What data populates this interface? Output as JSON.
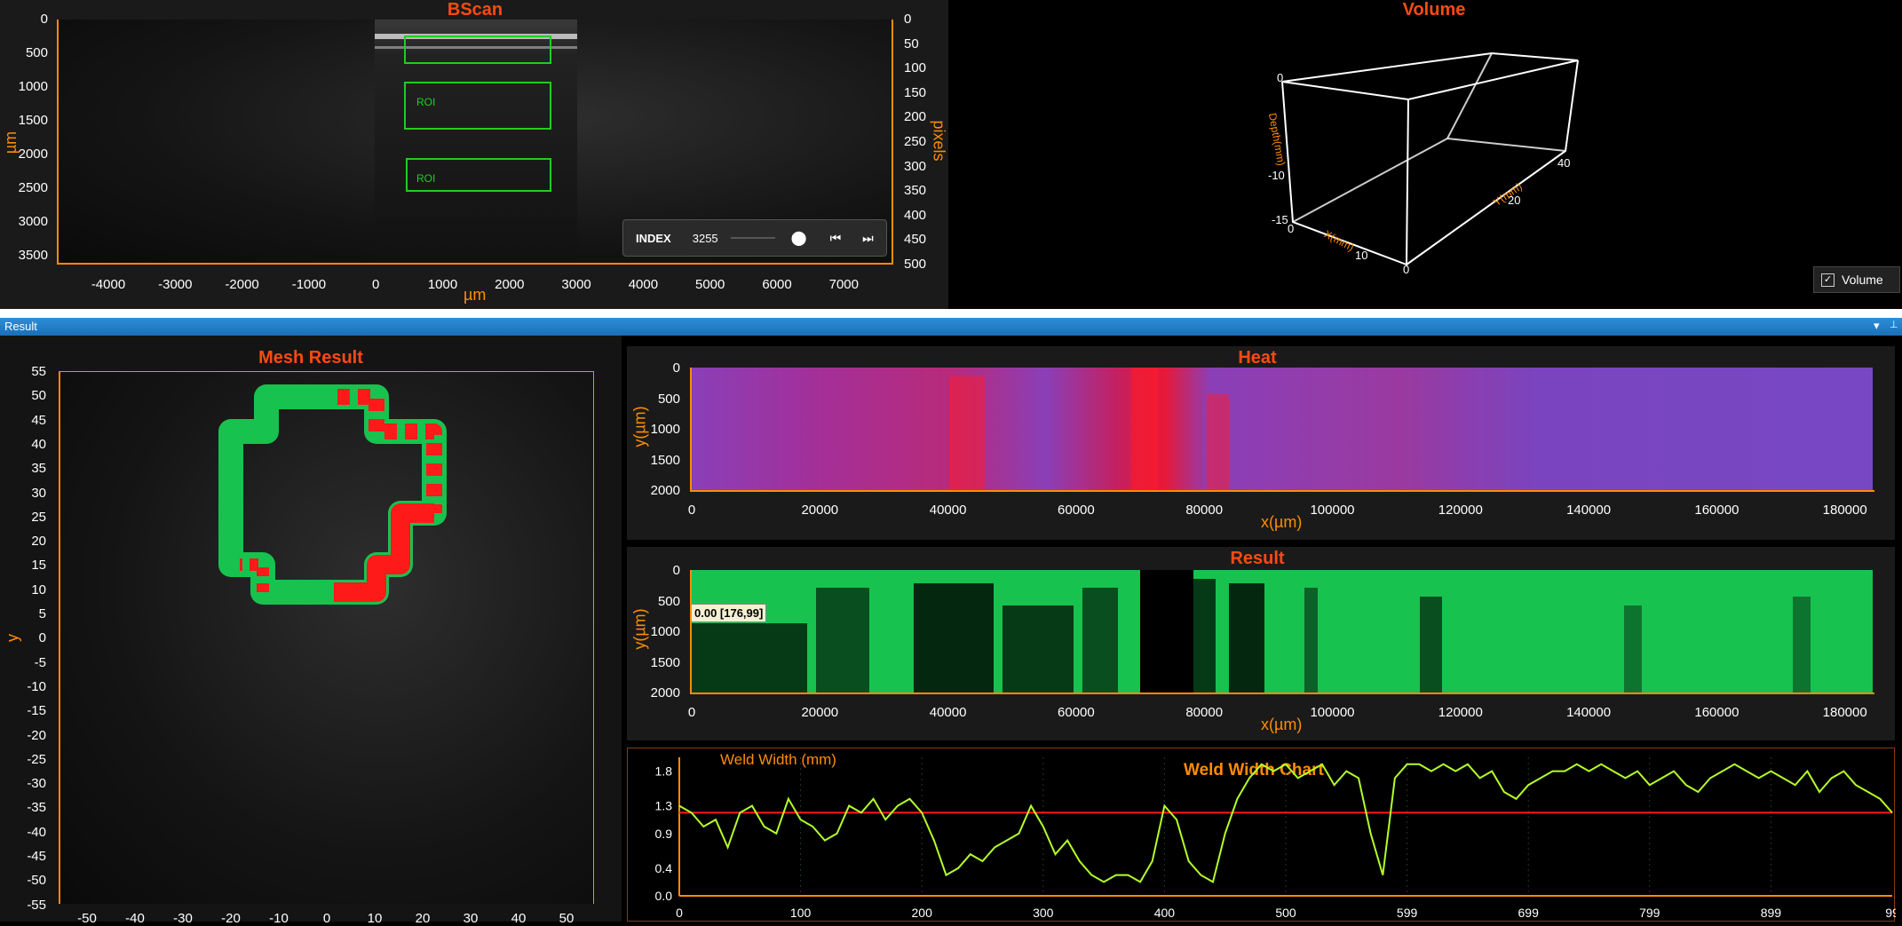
{
  "colors": {
    "accent": "#ff4a12",
    "axis": "#ff8c00",
    "roi": "#22cc22",
    "green": "#17c24f",
    "red": "#ff1a1a",
    "lime": "#b4ff28"
  },
  "bscan": {
    "title": "BScan",
    "left_ticks": [
      "0",
      "500",
      "1000",
      "1500",
      "2000",
      "2500",
      "3000",
      "3500"
    ],
    "left_label": "µm",
    "right_ticks": [
      "0",
      "50",
      "100",
      "150",
      "200",
      "250",
      "300",
      "350",
      "400",
      "450",
      "500"
    ],
    "right_label": "pixels",
    "bottom_ticks": [
      "-4000",
      "-3000",
      "-2000",
      "-1000",
      "0",
      "1000",
      "2000",
      "3000",
      "4000",
      "5000",
      "6000",
      "7000"
    ],
    "bottom_label": "µm",
    "roi_labels": [
      "ROI",
      "ROI",
      "ROI"
    ],
    "index_label": "INDEX",
    "index_value": "3255",
    "index_buttons": {
      "locate": "location-pin-icon",
      "first": "skip-first-icon",
      "last": "skip-last-icon"
    }
  },
  "volume": {
    "title": "Volume",
    "labels": {
      "x_axis": "X(mm)",
      "y_axis": "Y(mm)",
      "depth": "Depth(mm)"
    },
    "ticks": {
      "t0a": "0",
      "t10": "-10",
      "t15": "-15",
      "t0b": "0",
      "x10": "10",
      "x0": "0",
      "y20": "20",
      "y40": "40"
    },
    "checkbox_label": "Volume",
    "checkbox_checked": true
  },
  "result_header": {
    "label": "Result",
    "menu": "▾",
    "pin": "📌"
  },
  "mesh": {
    "title": "Mesh Result",
    "y_ticks": [
      "55",
      "50",
      "45",
      "40",
      "35",
      "30",
      "25",
      "20",
      "15",
      "10",
      "5",
      "0",
      "-5",
      "-10",
      "-15",
      "-20",
      "-25",
      "-30",
      "-35",
      "-40",
      "-45",
      "-50",
      "-55"
    ],
    "y_label": "y",
    "x_ticks": [
      "-50",
      "-40",
      "-30",
      "-20",
      "-10",
      "0",
      "10",
      "20",
      "30",
      "40",
      "50"
    ]
  },
  "heat": {
    "title": "Heat",
    "y_ticks": [
      "0",
      "500",
      "1000",
      "1500",
      "2000"
    ],
    "y_label": "y(µm)",
    "x_ticks": [
      "0",
      "20000",
      "40000",
      "60000",
      "80000",
      "100000",
      "120000",
      "140000",
      "160000",
      "180000"
    ],
    "x_label": "x(µm)"
  },
  "result_chart": {
    "title": "Result",
    "y_ticks": [
      "0",
      "500",
      "1000",
      "1500",
      "2000"
    ],
    "y_label": "y(µm)",
    "x_ticks": [
      "0",
      "20000",
      "40000",
      "60000",
      "80000",
      "100000",
      "120000",
      "140000",
      "160000",
      "180000"
    ],
    "x_label": "x(µm)",
    "tooltip": "0.00 [176,99]"
  },
  "chart_data": {
    "type": "line",
    "title": "Weld Width Chart",
    "ylabel": "Weld Width (mm)",
    "y_ticks": [
      "1.8",
      "1.3",
      "0.9",
      "0.4",
      "0.0"
    ],
    "x_ticks": [
      "0",
      "100",
      "200",
      "300",
      "400",
      "500",
      "599",
      "699",
      "799",
      "899",
      "99"
    ],
    "ylim": [
      0,
      2.0
    ],
    "xlim": [
      0,
      1000
    ],
    "threshold": 1.2,
    "series": [
      {
        "x": [
          0,
          10,
          20,
          30,
          40,
          50,
          60,
          70,
          80,
          90,
          100,
          110,
          120,
          130,
          140,
          150,
          160,
          170,
          180,
          190,
          200,
          210,
          220,
          230,
          240,
          250,
          260,
          270,
          280,
          290,
          300,
          310,
          320,
          330,
          340,
          350,
          360,
          370,
          380,
          390,
          400,
          410,
          420,
          430,
          440,
          450,
          460,
          470,
          480,
          490,
          500,
          510,
          520,
          530,
          540,
          550,
          560,
          570,
          580,
          590,
          600,
          610,
          620,
          630,
          640,
          650,
          660,
          670,
          680,
          690,
          700,
          710,
          720,
          730,
          740,
          750,
          760,
          770,
          780,
          790,
          800,
          810,
          820,
          830,
          840,
          850,
          860,
          870,
          880,
          890,
          900,
          910,
          920,
          930,
          940,
          950,
          960,
          970,
          980,
          990,
          1000
        ],
        "y": [
          1.3,
          1.2,
          1.0,
          1.1,
          0.7,
          1.2,
          1.3,
          1.0,
          0.9,
          1.4,
          1.1,
          1.0,
          0.8,
          0.9,
          1.3,
          1.2,
          1.4,
          1.1,
          1.3,
          1.4,
          1.2,
          0.8,
          0.3,
          0.4,
          0.6,
          0.5,
          0.7,
          0.8,
          0.9,
          1.3,
          1.0,
          0.6,
          0.8,
          0.5,
          0.3,
          0.2,
          0.3,
          0.3,
          0.2,
          0.5,
          1.3,
          1.1,
          0.5,
          0.3,
          0.2,
          0.9,
          1.4,
          1.7,
          1.9,
          1.8,
          1.9,
          1.7,
          1.8,
          1.9,
          1.6,
          1.8,
          1.7,
          0.9,
          0.3,
          1.7,
          1.9,
          1.9,
          1.8,
          1.9,
          1.8,
          1.9,
          1.7,
          1.8,
          1.5,
          1.4,
          1.6,
          1.7,
          1.8,
          1.8,
          1.9,
          1.8,
          1.9,
          1.8,
          1.7,
          1.8,
          1.6,
          1.7,
          1.8,
          1.6,
          1.5,
          1.7,
          1.8,
          1.9,
          1.8,
          1.7,
          1.8,
          1.7,
          1.6,
          1.8,
          1.5,
          1.7,
          1.8,
          1.6,
          1.5,
          1.4,
          1.2
        ]
      }
    ]
  }
}
